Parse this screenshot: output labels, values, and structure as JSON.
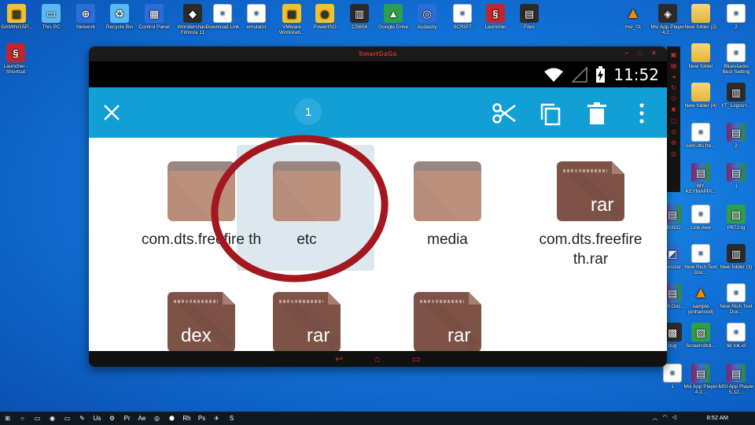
{
  "desktop": {
    "top_row": [
      {
        "label": "GAMINGSP...",
        "icon": "gaming-icon"
      },
      {
        "label": "This PC",
        "icon": "pc-icon"
      },
      {
        "label": "Network",
        "icon": "network-icon"
      },
      {
        "label": "Recycle Bin",
        "icon": "recycle-icon"
      },
      {
        "label": "Control Panel",
        "icon": "control-panel-icon"
      },
      {
        "label": "Wondershare Filmora 11",
        "icon": "filmora-icon"
      },
      {
        "label": "Download Link",
        "icon": "document-icon"
      },
      {
        "label": "emulator",
        "icon": "document-icon"
      },
      {
        "label": "VMware Workstati...",
        "icon": "vmware-icon"
      },
      {
        "label": "PowerISO",
        "icon": "poweriso-icon"
      },
      {
        "label": "CS604",
        "icon": "book-icon"
      },
      {
        "label": "Google Drive",
        "icon": "drive-icon"
      },
      {
        "label": "Audacity",
        "icon": "audacity-icon"
      },
      {
        "label": "SCRIPT",
        "icon": "document-icon"
      },
      {
        "label": "Launcher",
        "icon": "launcher-icon"
      },
      {
        "label": "Files",
        "icon": "files-icon"
      },
      {
        "label": "msi_01",
        "icon": "cone-icon"
      },
      {
        "label": "Msi App Player 4.2...",
        "icon": "msi-icon"
      },
      {
        "label": "New folder (2)",
        "icon": "folder-icon"
      },
      {
        "label": "2",
        "icon": "document-icon"
      }
    ],
    "left_col": [
      {
        "label": "Launcher - Shortcut",
        "icon": "launcher-icon"
      }
    ],
    "right_col": [
      {
        "label": "New folder",
        "icon": "folder-icon"
      },
      {
        "label": "Bluestacks Best Setting",
        "icon": "document-icon"
      },
      {
        "label": "New folder (4)",
        "icon": "folder-icon"
      },
      {
        "label": "YT_Logos+...",
        "icon": "book-icon"
      },
      {
        "label": "com.dts.fre...",
        "icon": "document-icon"
      },
      {
        "label": "2",
        "icon": "rar-icon"
      },
      {
        "label": "MY KEYMAPPI...",
        "icon": "rar-icon"
      },
      {
        "label": "1",
        "icon": "rar-icon"
      },
      {
        "label": "200502",
        "icon": "rar-icon"
      },
      {
        "label": "Link new",
        "icon": "document-icon"
      },
      {
        "label": "P672-lg",
        "icon": "image-icon"
      },
      {
        "label": "Resizer",
        "icon": "resizer-icon"
      },
      {
        "label": "New Rich Text Doc...",
        "icon": "document-icon"
      },
      {
        "label": "New folder (3)",
        "icon": "book-icon"
      },
      {
        "label": "Rich Doc...",
        "icon": "rar-icon"
      },
      {
        "label": "sample (enhanced)",
        "icon": "cone-icon"
      },
      {
        "label": "New Rich Text Doc...",
        "icon": "document-icon"
      },
      {
        "label": "oug",
        "icon": "dark-icon"
      },
      {
        "label": "Screenshot...",
        "icon": "image-icon"
      },
      {
        "label": "tik tok id",
        "icon": "document-icon"
      },
      {
        "label": "1",
        "icon": "document-icon"
      },
      {
        "label": "Msi App Player 4.2...",
        "icon": "rar-icon"
      },
      {
        "label": "MSI App Player 5.12...",
        "icon": "rar-icon"
      }
    ]
  },
  "emulator": {
    "brand": "SmartGaGa",
    "window_buttons": [
      "–",
      "□",
      "×"
    ],
    "status_time": "11:52",
    "selected_count": "1",
    "files": [
      {
        "label": "com.dts.freefire th",
        "type": "folder",
        "badge": ""
      },
      {
        "label": "etc",
        "type": "folder",
        "badge": ""
      },
      {
        "label": "media",
        "type": "folder",
        "badge": ""
      },
      {
        "label": "com.dts.freefire th.rar",
        "type": "archive",
        "badge": "rar"
      },
      {
        "label": "",
        "type": "archive",
        "badge": "dex"
      },
      {
        "label": "",
        "type": "archive",
        "badge": "rar"
      },
      {
        "label": "",
        "type": "archive",
        "badge": "rar"
      }
    ]
  },
  "taskbar": {
    "clock": "8:52 AM",
    "items": [
      "⊞",
      "○",
      "▭",
      "◉",
      "▭",
      "✎",
      "Us",
      "⚙",
      "Pr",
      "Ae",
      "◎",
      "⬢",
      "Rh",
      "Ps",
      "✈",
      "S"
    ]
  },
  "colors": {
    "accent": "#119fd6",
    "folder": "#b78c79",
    "archive": "#7d5348",
    "circle": "#a3171f"
  }
}
